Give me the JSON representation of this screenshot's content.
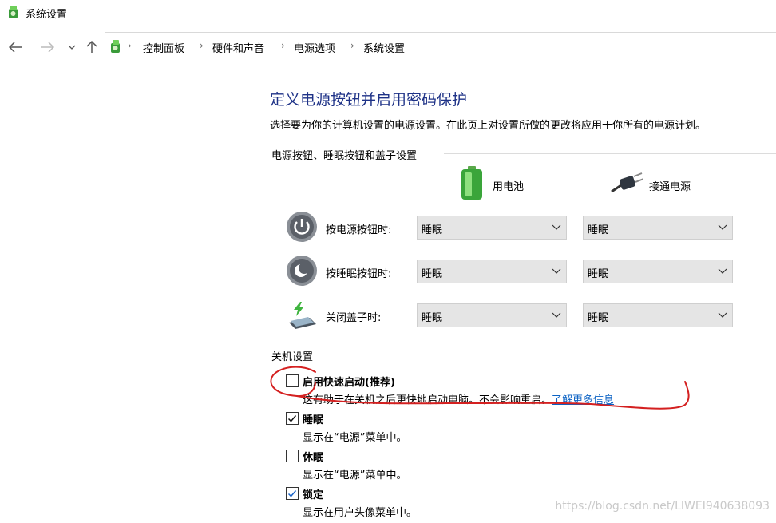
{
  "window": {
    "title": "系统设置",
    "icon": "control-panel-icon"
  },
  "nav": {
    "back": "back-arrow-icon",
    "forward": "forward-arrow-icon",
    "recent": "chevron-down-icon",
    "up": "up-arrow-icon"
  },
  "breadcrumb": [
    "控制面板",
    "硬件和声音",
    "电源选项",
    "系统设置"
  ],
  "page": {
    "title": "定义电源按钮并启用密码保护",
    "description": "选择要为你的计算机设置的电源设置。在此页上对设置所做的更改将应用于你所有的电源计划。"
  },
  "buttons_group": {
    "header": "电源按钮、睡眠按钮和盖子设置",
    "battery_label": "用电池",
    "plugged_label": "接通电源",
    "rows": [
      {
        "label": "按电源按钮时:",
        "icon": "power-button-icon",
        "battery": "睡眠",
        "plugged": "睡眠"
      },
      {
        "label": "按睡眠按钮时:",
        "icon": "sleep-button-icon",
        "battery": "睡眠",
        "plugged": "睡眠"
      },
      {
        "label": "关闭盖子时:",
        "icon": "laptop-lid-icon",
        "battery": "睡眠",
        "plugged": "睡眠"
      }
    ]
  },
  "shutdown_group": {
    "header": "关机设置",
    "options": [
      {
        "label": "启用快速启动(推荐)",
        "description": "这有助于在关机之后更快地启动电脑。不会影响重启。",
        "link": "了解更多信息",
        "checked": false
      },
      {
        "label": "睡眠",
        "description": "显示在“电源”菜单中。",
        "checked": true
      },
      {
        "label": "休眠",
        "description": "显示在“电源”菜单中。",
        "checked": false
      },
      {
        "label": "锁定",
        "description": "显示在用户头像菜单中。",
        "checked": true
      }
    ]
  },
  "watermark": "https://blog.csdn.net/LIWEI940638093",
  "colors": {
    "title_blue": "#1e3287",
    "link_blue": "#0b62c4",
    "annotation_red": "#d42020"
  }
}
